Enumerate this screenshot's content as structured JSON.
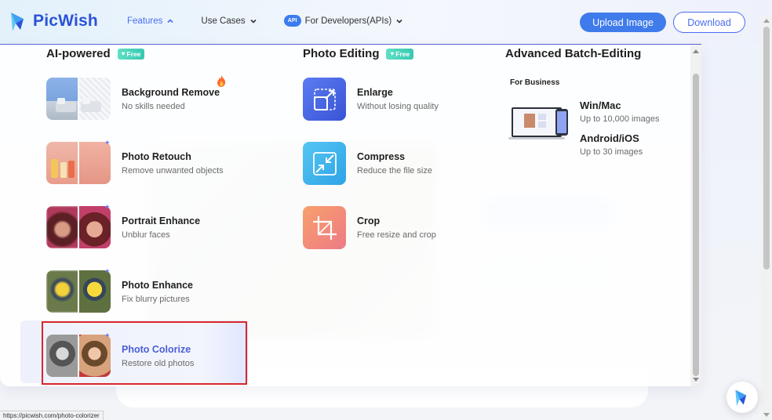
{
  "header": {
    "brand": "PicWish",
    "nav": [
      {
        "label": "Features",
        "active": true
      },
      {
        "label": "Use Cases",
        "active": false
      },
      {
        "label": "For Developers(APIs)",
        "active": false,
        "badge": "API"
      }
    ],
    "upload_label": "Upload Image",
    "download_label": "Download"
  },
  "dropdown": {
    "ai": {
      "title": "AI-powered",
      "badge": "Free",
      "items": [
        {
          "title": "Background Remove",
          "subtitle": "No skills needed",
          "hot": true
        },
        {
          "title": "Photo Retouch",
          "subtitle": "Remove unwanted objects"
        },
        {
          "title": "Portrait Enhance",
          "subtitle": "Unblur faces"
        },
        {
          "title": "Photo Enhance",
          "subtitle": "Fix blurry pictures"
        },
        {
          "title": "Photo Colorize",
          "subtitle": "Restore old photos",
          "selected": true
        }
      ]
    },
    "editing": {
      "title": "Photo Editing",
      "badge": "Free",
      "items": [
        {
          "title": "Enlarge",
          "subtitle": "Without losing quality",
          "icon": "enlarge-icon"
        },
        {
          "title": "Compress",
          "subtitle": "Reduce the file size",
          "icon": "compress-icon"
        },
        {
          "title": "Crop",
          "subtitle": "Free resize and crop",
          "icon": "crop-icon"
        }
      ]
    },
    "batch": {
      "title": "Advanced Batch-Editing",
      "for_business": "For Business",
      "items": [
        {
          "title": "Win/Mac",
          "subtitle": "Up to 10,000 images"
        },
        {
          "title": "Android/iOS",
          "subtitle": "Up to 30 images"
        }
      ]
    }
  },
  "status_url": "https://picwish.com/photo-colorizer",
  "colors": {
    "brand": "#2b53d6",
    "accent": "#4a6cf0",
    "selection_outline": "#d9262b",
    "free_badge": "#37c8b0"
  }
}
